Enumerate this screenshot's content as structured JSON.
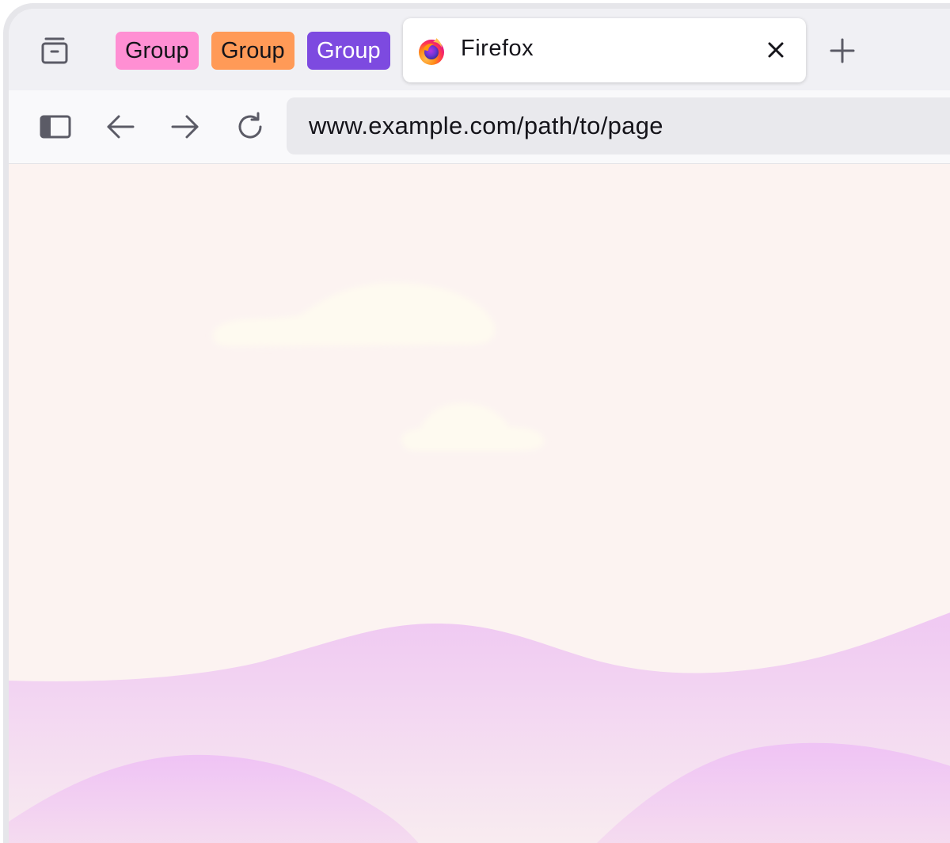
{
  "tab_groups": [
    {
      "label": "Group",
      "color": "#ff8fd3",
      "text_color": "#15141a"
    },
    {
      "label": "Group",
      "color": "#ff9a57",
      "text_color": "#15141a"
    },
    {
      "label": "Group",
      "color": "#7d4ae0",
      "text_color": "#ffffff"
    }
  ],
  "active_tab": {
    "title": "Firefox",
    "favicon": "firefox-logo-icon",
    "close_icon": "close-icon"
  },
  "toolbar_icons": {
    "tab_overview": "tab-overview-icon",
    "new_tab": "plus-icon",
    "sidebar": "sidebar-toggle-icon",
    "back": "arrow-left-icon",
    "forward": "arrow-right-icon",
    "reload": "reload-icon"
  },
  "address_bar": {
    "url": "www.example.com/path/to/page"
  },
  "colors": {
    "tabstrip_bg": "#f0f0f4",
    "navbar_bg": "#f9f9fb",
    "urlbar_bg": "#e9e9ed",
    "content_bg": "#fcf3f1",
    "hill_color": "#eec6f2"
  }
}
